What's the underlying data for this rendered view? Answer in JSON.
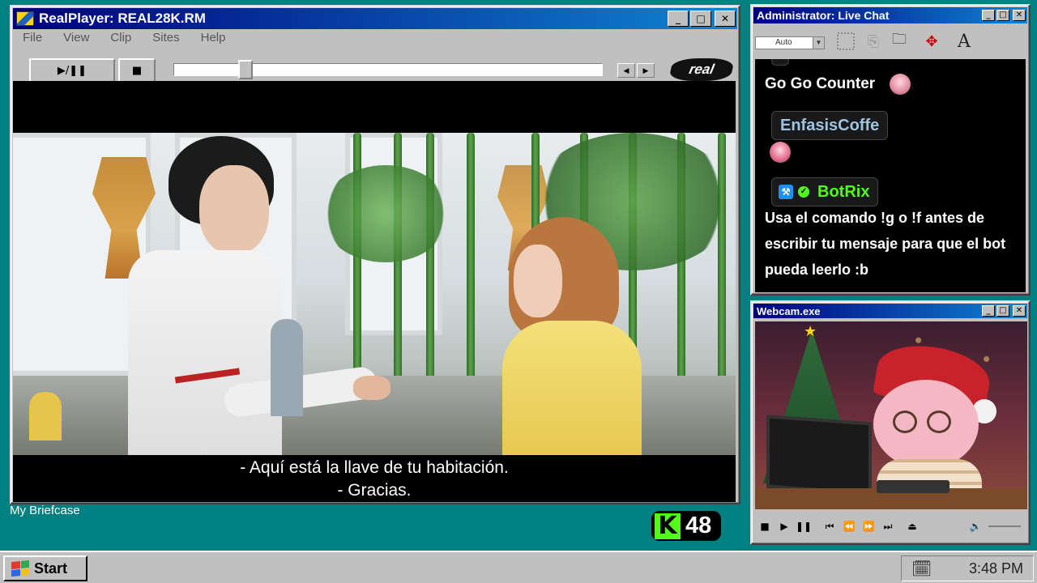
{
  "realplayer": {
    "title": "RealPlayer: REAL28K.RM",
    "menu": [
      "File",
      "View",
      "Clip",
      "Sites",
      "Help"
    ],
    "play_pause": "▶/❚❚",
    "stop": "■",
    "logo": "real",
    "seek_progress": 0.15,
    "subtitles": [
      "- Aquí está la llave de tu habitación.",
      "- Gracias."
    ]
  },
  "desktop": {
    "briefcase_label": "My Briefcase"
  },
  "counter": {
    "icon": "K",
    "value": "48",
    "accent": "#53fc18"
  },
  "chat": {
    "title": "Administrator: Live Chat",
    "select_value": "Auto",
    "tools": [
      "select-region",
      "copy",
      "open",
      "move",
      "A"
    ],
    "messages": [
      {
        "user": "",
        "text": "Go Go Counter"
      },
      {
        "user": "EnfasisCoffe",
        "user_color": "#9cc4e4",
        "text": ""
      },
      {
        "user": "BotRix",
        "user_color": "#53fc18",
        "text": "Usa el comando !g o !f antes de escribir tu mensaje para que el bot pueda leerlo :b"
      }
    ]
  },
  "webcam": {
    "title": "Webcam.exe",
    "controls": [
      "■",
      "▶",
      "❚❚",
      "⏮",
      "⏪",
      "⏩",
      "⏭",
      "⏏",
      "🔈"
    ]
  },
  "taskbar": {
    "start_label": "Start",
    "time": "3:48 PM"
  },
  "colors": {
    "desktop": "#008080",
    "titlebar_start": "#000080",
    "titlebar_end": "#1084d0"
  }
}
